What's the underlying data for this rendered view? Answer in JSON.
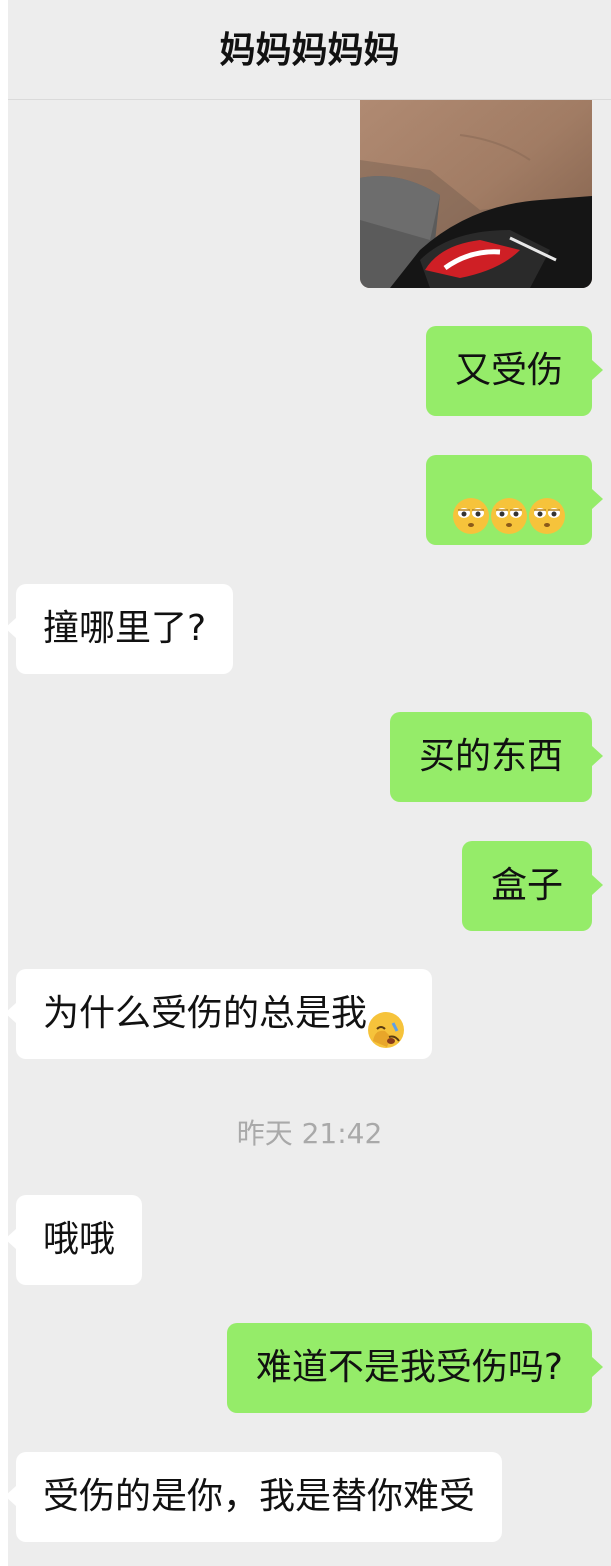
{
  "chat": {
    "title": "妈妈妈妈妈"
  },
  "messages": {
    "m1": {
      "text": "又受伤",
      "sender": "me"
    },
    "m2": {
      "emoji": [
        "flushed-eyes-emoji",
        "flushed-eyes-emoji",
        "flushed-eyes-emoji"
      ],
      "sender": "me"
    },
    "m3": {
      "text": "撞哪里了?",
      "sender": "them"
    },
    "m4": {
      "text": "买的东西",
      "sender": "me"
    },
    "m5": {
      "text": "盒子",
      "sender": "me"
    },
    "m6": {
      "text": "为什么受伤的总是我",
      "emoji": "face-palm-emoji",
      "sender": "them"
    },
    "m7": {
      "text": "哦哦",
      "sender": "them"
    },
    "m8": {
      "text": "难道不是我受伤吗?",
      "sender": "me"
    },
    "m9": {
      "text": "受伤的是你，我是替你难受",
      "sender": "them"
    }
  },
  "timestamp": {
    "text": "昨天 21:42"
  },
  "colors": {
    "my_bubble": "#95ec69",
    "their_bubble": "#ffffff",
    "background": "#ededed",
    "timestamp": "#a9a9a9"
  }
}
